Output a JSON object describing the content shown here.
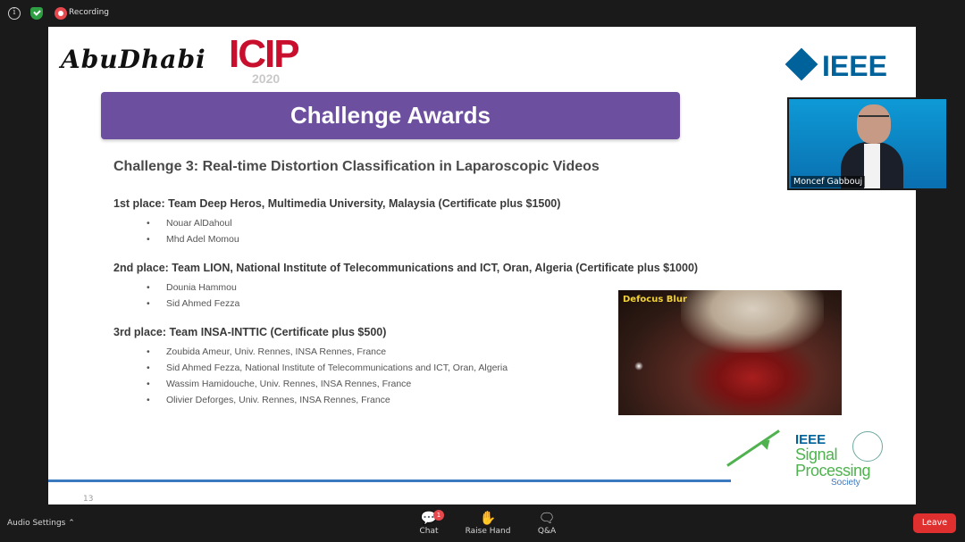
{
  "topbar": {
    "recording_label": "Recording"
  },
  "slide": {
    "logo_left_text": "AbuDhabi",
    "logo_icip_text": "ICIP",
    "logo_icip_year": "2020",
    "ieee_logo_text": "IEEE",
    "banner_title": "Challenge Awards",
    "challenge_title": "Challenge 3: Real-time Distortion Classification in Laparoscopic Videos",
    "places": [
      {
        "title": "1st place: Team Deep Heros, Multimedia University, Malaysia (Certificate plus $1500)",
        "members": [
          "Nouar AlDahoul",
          "Mhd Adel Momou"
        ]
      },
      {
        "title": "2nd place: Team LION, National Institute of Telecommunications and ICT, Oran, Algeria (Certificate plus $1000)",
        "members": [
          "Dounia Hammou",
          "Sid Ahmed Fezza"
        ]
      },
      {
        "title": "3rd place: Team INSA-INTTIC (Certificate plus $500)",
        "members": [
          "Zoubida Ameur, Univ. Rennes, INSA Rennes, France",
          "Sid Ahmed Fezza, National Institute of Telecommunications and ICT, Oran, Algeria",
          "Wassim Hamidouche, Univ. Rennes, INSA Rennes, France",
          "Olivier Deforges, Univ. Rennes, INSA Rennes, France"
        ]
      }
    ],
    "image_label": "Defocus Blur",
    "page_number": "13",
    "sps_logo": {
      "ieee": "IEEE",
      "line1": "Signal",
      "line2": "Processing",
      "society": "Society"
    }
  },
  "video_tile": {
    "participant_name": "Moncef Gabbouj"
  },
  "bottombar": {
    "audio_settings_label": "Audio Settings",
    "chat_label": "Chat",
    "chat_badge": "1",
    "raise_hand_label": "Raise Hand",
    "qa_label": "Q&A",
    "leave_label": "Leave"
  }
}
